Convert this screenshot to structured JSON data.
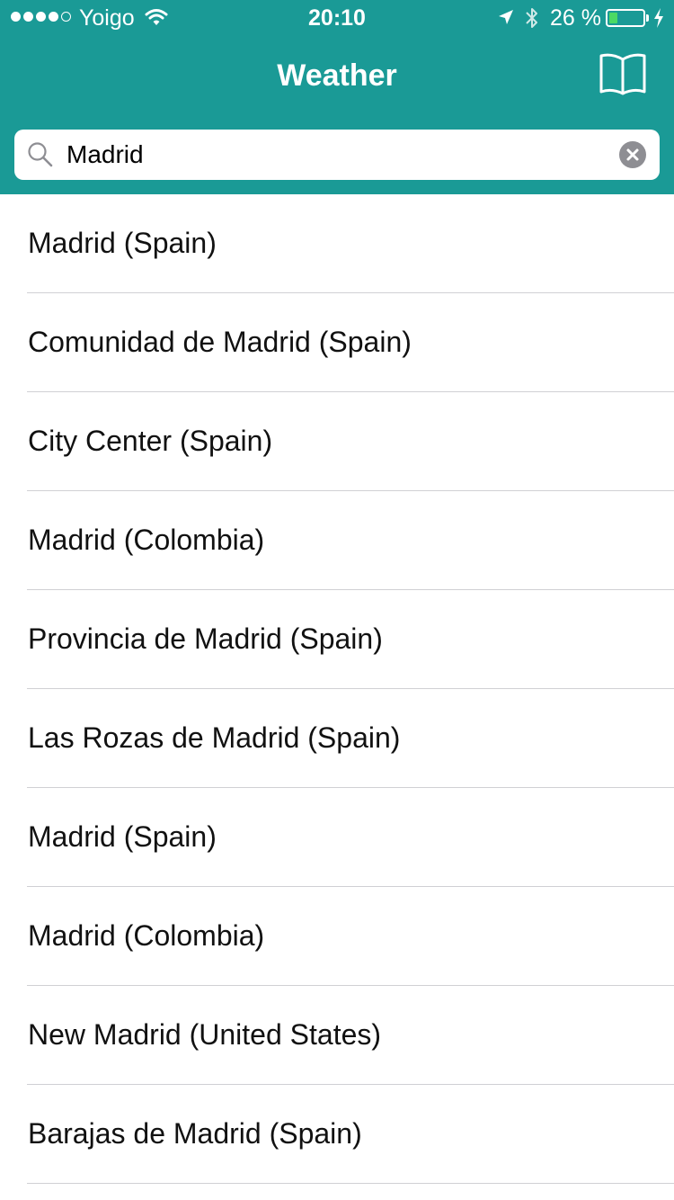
{
  "status_bar": {
    "carrier": "Yoigo",
    "time": "20:10",
    "battery_percent": "26 %",
    "battery_level": 0.26,
    "signal_bars_filled": 4,
    "signal_bars_total": 5,
    "battery_fill_color": "#4cd964"
  },
  "nav": {
    "title": "Weather",
    "bookmarks_icon": "book-open-icon",
    "background_color": "#1a9a96"
  },
  "search": {
    "value": "Madrid",
    "placeholder": "Search",
    "search_icon": "magnifier-icon",
    "clear_icon": "clear-circle-icon"
  },
  "results": [
    "Madrid (Spain)",
    "Comunidad de Madrid (Spain)",
    "City Center (Spain)",
    "Madrid (Colombia)",
    "Provincia de Madrid (Spain)",
    "Las Rozas de Madrid (Spain)",
    "Madrid (Spain)",
    "Madrid (Colombia)",
    "New Madrid (United States)",
    "Barajas de Madrid (Spain)"
  ]
}
